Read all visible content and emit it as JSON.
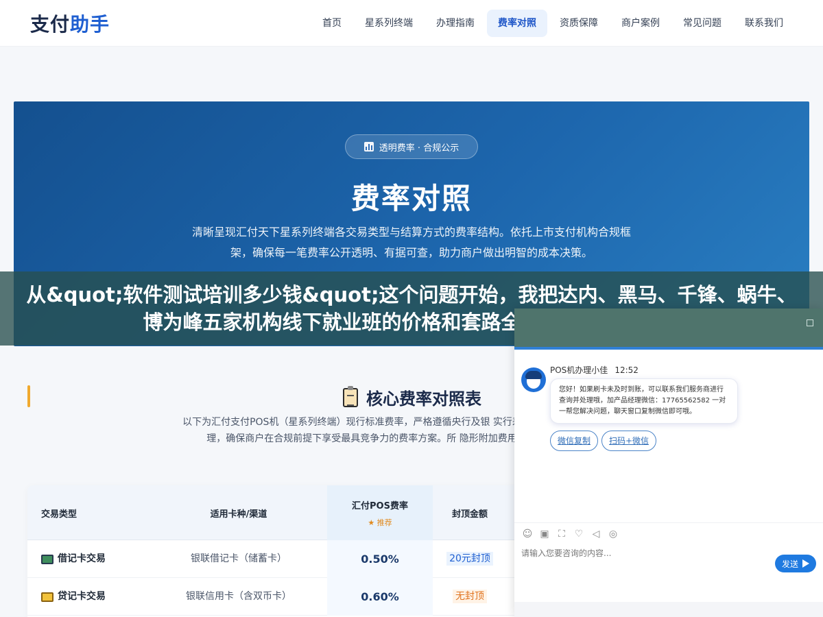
{
  "logo": {
    "part1": "支付",
    "part2": "助手"
  },
  "nav": {
    "items": [
      "首页",
      "星系列终端",
      "办理指南",
      "费率对照",
      "资质保障",
      "商户案例",
      "常见问题",
      "联系我们"
    ],
    "active_index": 3
  },
  "hero": {
    "badge": "透明费率 · 合规公示",
    "title": "费率对照",
    "desc": "清晰呈现汇付天下星系列终端各交易类型与结算方式的费率结构。依托上市支付机构合规框架，确保每一笔费率公开透明、有据可查，助力商户做出明智的成本决策。"
  },
  "banner": {
    "text": "从&quot;软件测试培训多少钱&quot;这个问题开始，我把达内、黑马、千锋、蜗牛、博为峰五家机构线下就业班的价格和套路全部跑了一遍，线下"
  },
  "section": {
    "title": "核心费率对照表",
    "desc": "以下为汇付支付POS机（星系列终端）现行标准费率，严格遵循央行及银 实行差异化管理，确保商户在合规前提下享受最具竞争力的费率方案。所 隐形附加费用。"
  },
  "table": {
    "headers": {
      "type": "交易类型",
      "card": "适用卡种/渠道",
      "rate": "汇付POS费率",
      "recommend": "★ 推荐",
      "cap": "封顶金额"
    },
    "rows": [
      {
        "type": "借记卡交易",
        "card": "银联借记卡（储蓄卡）",
        "rate": "0.50%",
        "cap": "20元封顶"
      },
      {
        "type": "贷记卡交易",
        "card": "银联信用卡（含双币卡）",
        "rate": "0.60%",
        "cap": "无封顶"
      }
    ]
  },
  "chat": {
    "agent": "POS机办理小佳",
    "time": "12:52",
    "message": "您好！如果刷卡未及时到账，可以联系我们服务商进行查询并处理哦，加产品经理微信：17765562582 一对一帮您解决问题，聊天窗口复制微信即可哦。",
    "btn_copy": "微信复制",
    "btn_scan": "扫码+微信",
    "placeholder": "请输入您要咨询的内容...",
    "send": "发送"
  },
  "colors": {
    "accent": "#1f5fd1",
    "hero": "#1d66ad",
    "send": "#1f7ae0",
    "cap_orange": "#e0731f"
  }
}
